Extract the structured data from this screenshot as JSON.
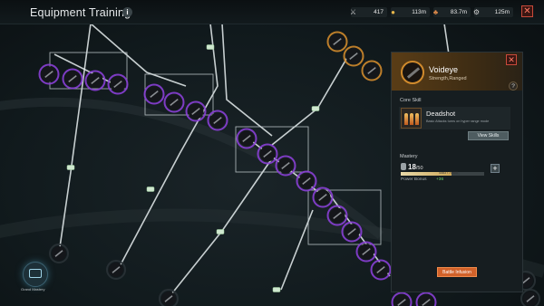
{
  "header": {
    "title": "Equipment Training",
    "info_icon": "info-icon",
    "close_icon": "close-icon"
  },
  "resources": [
    {
      "icon": "weapon-icon",
      "value": "417"
    },
    {
      "icon": "gold-icon",
      "value": "113m"
    },
    {
      "icon": "food-icon",
      "value": "83.7m"
    },
    {
      "icon": "gear-icon",
      "value": "125m"
    }
  ],
  "panel": {
    "weapon_name": "Voideye",
    "weapon_type": "Strength,Ranged",
    "help_label": "?",
    "close_label": "✕",
    "core_skill_label": "Core Skill",
    "skill_name": "Deadshot",
    "skill_desc": "Basic Attacks turns on hyper range mode",
    "view_skills_label": "View Skills",
    "mastery_label": "Mastery",
    "mastery_level": "18",
    "mastery_max": "/50",
    "mastery_progress_text": "4583 / 75400",
    "mastery_progress": 0.61,
    "plus_label": "+",
    "power_bonus_label": "Power Bonus",
    "power_bonus_value": "+36",
    "battle_infusion_label": "Battle Infusion"
  },
  "grand_mastery_label": "Grand Mastery",
  "colors": {
    "purple_node": "#8a3fd6",
    "gold_node": "#d08a2c",
    "path": "#e8eef0",
    "button_orange": "#d2622a"
  }
}
